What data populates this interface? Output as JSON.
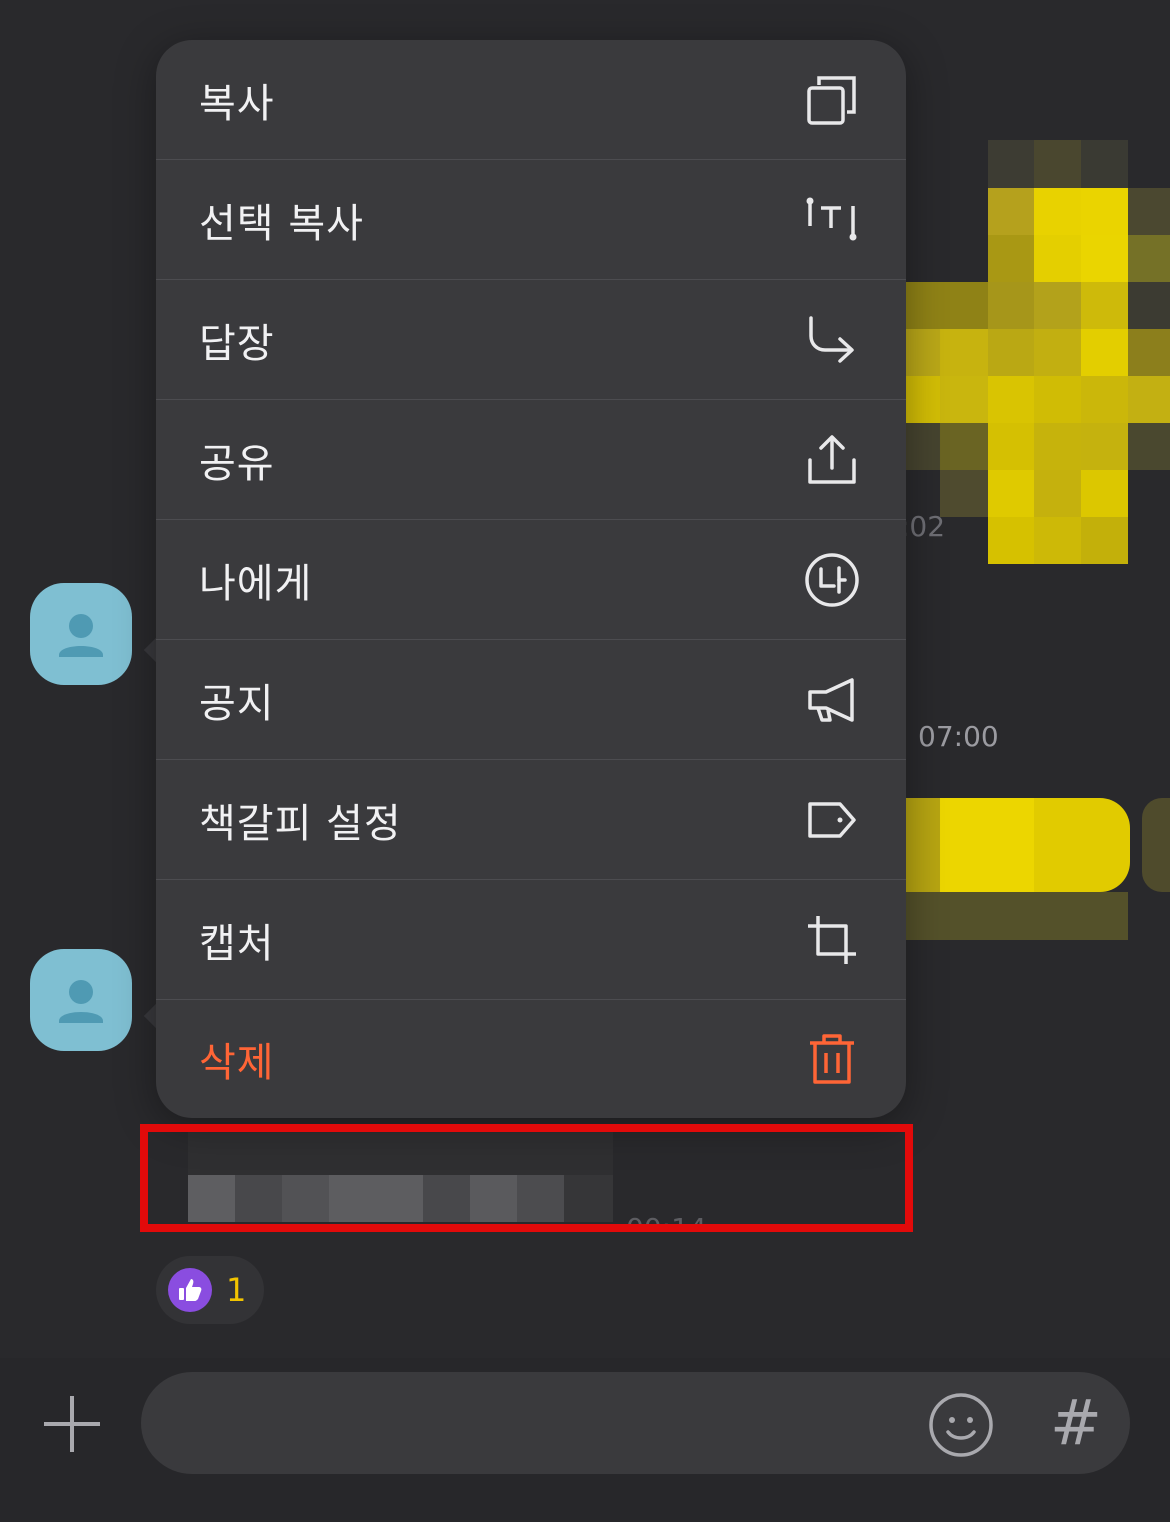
{
  "menu": {
    "items": [
      {
        "label": "복사",
        "icon": "copy-icon"
      },
      {
        "label": "선택 복사",
        "icon": "text-select-icon"
      },
      {
        "label": "답장",
        "icon": "reply-arrow-icon"
      },
      {
        "label": "공유",
        "icon": "share-icon"
      },
      {
        "label": "나에게",
        "icon": "to-me-icon"
      },
      {
        "label": "공지",
        "icon": "megaphone-icon"
      },
      {
        "label": "책갈피 설정",
        "icon": "bookmark-tag-icon"
      },
      {
        "label": "캡처",
        "icon": "crop-icon"
      },
      {
        "label": "삭제",
        "icon": "trash-icon",
        "color": "#ff6536"
      }
    ]
  },
  "chat": {
    "timestamps": [
      ":02",
      "07:00",
      "00:14"
    ],
    "reaction": {
      "icon": "thumbs-up-icon",
      "count": "1"
    }
  },
  "input": {
    "hash_label": "#"
  },
  "colors": {
    "accent_danger": "#ff6536",
    "highlight": "#e20a0a",
    "reaction_badge": "#8a4de0",
    "reaction_count": "#f2c400"
  }
}
